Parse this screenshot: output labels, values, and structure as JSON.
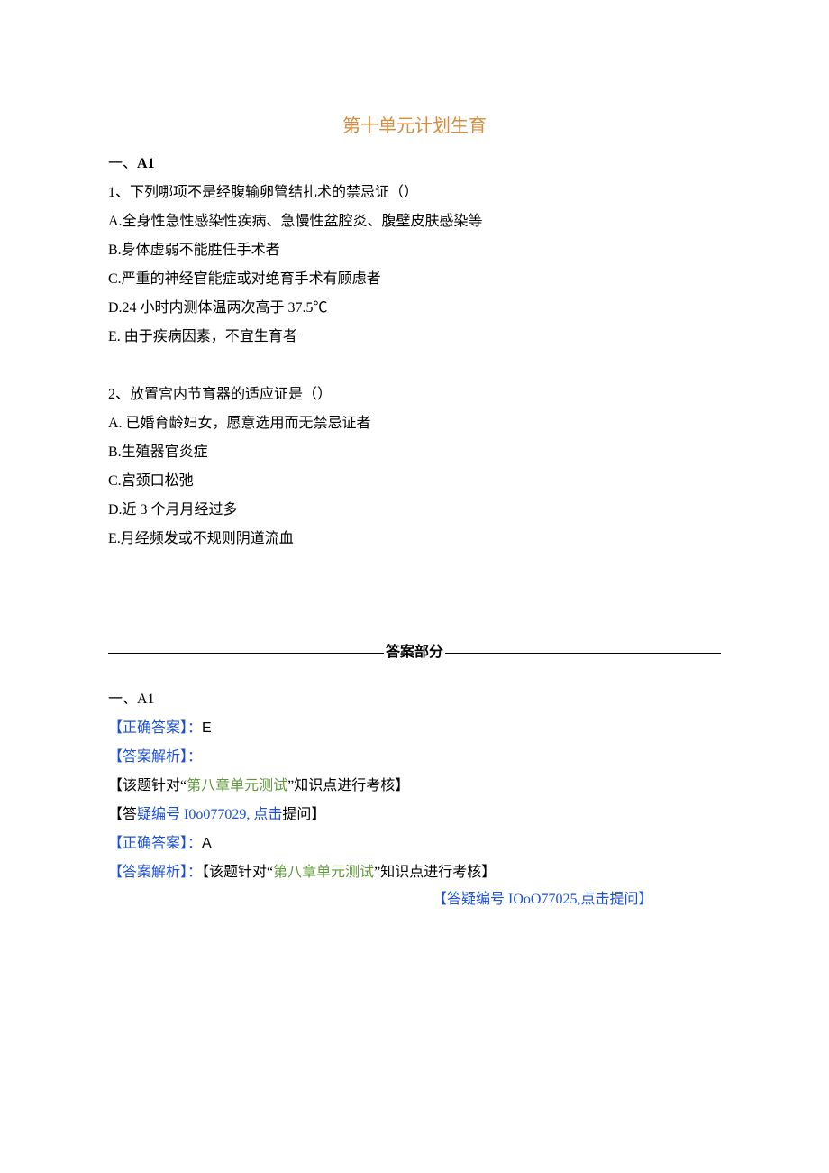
{
  "title": "第十单元计划生育",
  "section1": {
    "heading_prefix": "一、",
    "heading_latin": "A1"
  },
  "q1": {
    "stem": "1、下列哪项不是经腹输卵管结扎术的禁忌证（）",
    "A": "A.全身性急性感染性疾病、急慢性盆腔炎、腹壁皮肤感染等",
    "B": "B.身体虚弱不能胜任手术者",
    "C": "C.严重的神经官能症或对绝育手术有顾虑者",
    "D": "D.24 小时内测体温两次高于 37.5℃",
    "E": "E. 由于疾病因素，不宜生育者"
  },
  "q2": {
    "stem": "2、放置宫内节育器的适应证是（）",
    "A": "A. 已婚育龄妇女，愿意选用而无禁忌证者",
    "B": "B.生殖器官炎症",
    "C": "C.宫颈口松弛",
    "D": "D.近 3 个月月经过多",
    "E": "E.月经频发或不规则阴道流血"
  },
  "answers_label": "答案部分",
  "ans_section_heading": "一、A1",
  "ans1": {
    "correct_label": "【正确答案】：",
    "correct_value": "E",
    "analysis_label": "【答案解析】：",
    "note_open": "【该题针对“",
    "note_topic": "第八章单元测试",
    "note_close": "”知识点进行考核】",
    "qnum_open": "【答",
    "qnum_mid": "疑编号 I0o077029, ",
    "qnum_link": "点击",
    "qnum_close": "提问】"
  },
  "ans2": {
    "correct_label": "【正确答案】：",
    "correct_value": "A",
    "analysis_label": "【答案解析】：",
    "analysis_open": "【该题针对“",
    "analysis_topic": "第八章单元测试",
    "analysis_close": "”知识点进行考核】",
    "qnum_open": "【答疑编号 IOoO77025,",
    "qnum_link": "点击提问",
    "qnum_close": "】"
  }
}
